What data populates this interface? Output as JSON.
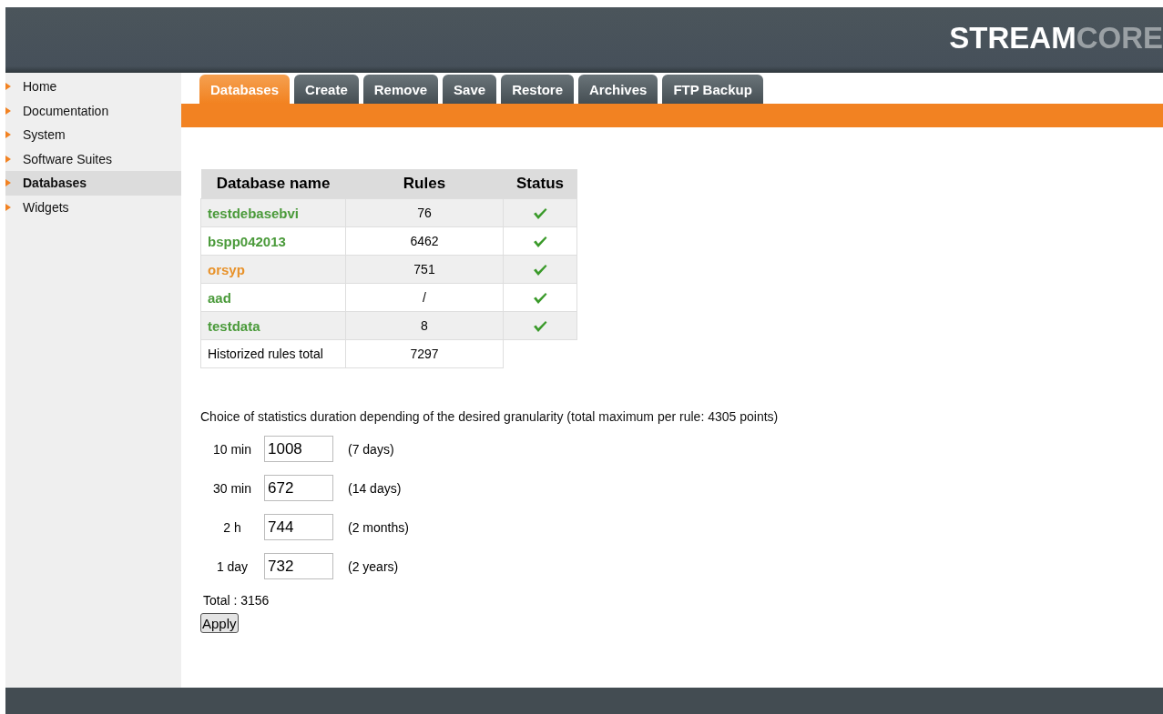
{
  "logo": {
    "primary": "STREAM",
    "secondary": "CORE"
  },
  "sidebar": {
    "items": [
      {
        "label": "Home",
        "selected": false
      },
      {
        "label": "Documentation",
        "selected": false
      },
      {
        "label": "System",
        "selected": false
      },
      {
        "label": "Software Suites",
        "selected": false
      },
      {
        "label": "Databases",
        "selected": true
      },
      {
        "label": "Widgets",
        "selected": false
      }
    ]
  },
  "tabs": [
    {
      "label": "Databases",
      "selected": true
    },
    {
      "label": "Create",
      "selected": false
    },
    {
      "label": "Remove",
      "selected": false
    },
    {
      "label": "Save",
      "selected": false
    },
    {
      "label": "Restore",
      "selected": false
    },
    {
      "label": "Archives",
      "selected": false
    },
    {
      "label": "FTP Backup",
      "selected": false
    }
  ],
  "table": {
    "columns": [
      "Database name",
      "Rules",
      "Status"
    ],
    "rows": [
      {
        "name": "testdebasebvi",
        "color": "#4a9a3a",
        "rules": "76",
        "ok": true
      },
      {
        "name": "bspp042013",
        "color": "#4a9a3a",
        "rules": "6462",
        "ok": true
      },
      {
        "name": "orsyp",
        "color": "#e8922a",
        "rules": "751",
        "ok": true
      },
      {
        "name": "aad",
        "color": "#4a9a3a",
        "rules": "/",
        "ok": true
      },
      {
        "name": "testdata",
        "color": "#4a9a3a",
        "rules": "8",
        "ok": true
      }
    ],
    "total": {
      "label": "Historized rules total",
      "value": "7297"
    }
  },
  "statistics": {
    "description": "Choice of statistics duration depending of the desired granularity (total maximum per rule: 4305 points)",
    "durations": [
      {
        "label": "10 min",
        "value": "1008",
        "note": "(7 days)"
      },
      {
        "label": "30 min",
        "value": "672",
        "note": "(14 days)"
      },
      {
        "label": "2 h",
        "value": "744",
        "note": "(2 months)"
      },
      {
        "label": "1 day",
        "value": "732",
        "note": "(2 years)"
      }
    ],
    "total": "Total : 3156",
    "apply_button": "Apply"
  }
}
